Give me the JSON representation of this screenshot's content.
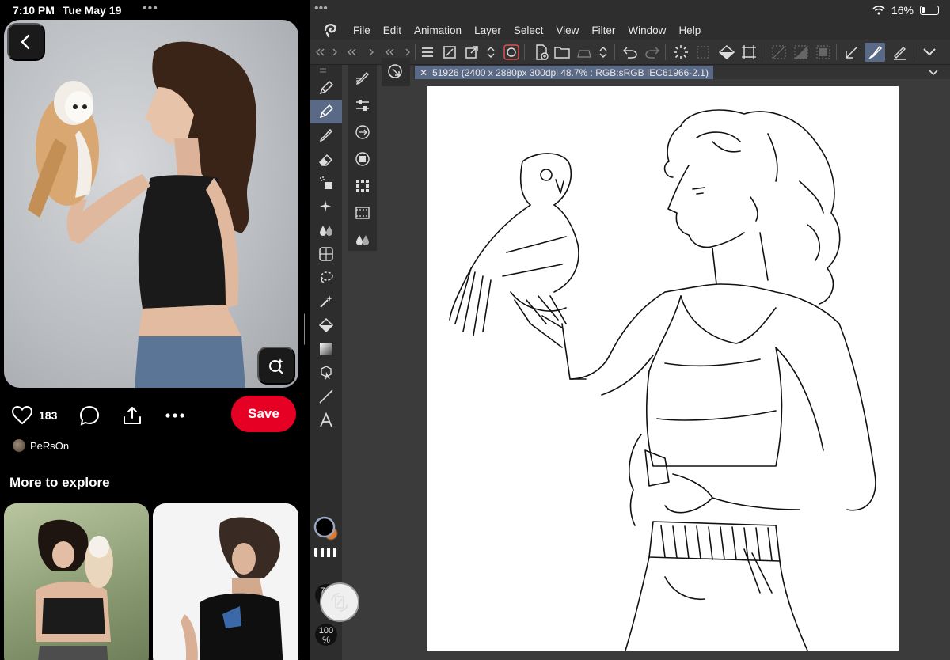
{
  "left": {
    "status": {
      "time": "7:10 PM",
      "date": "Tue May 19"
    },
    "pin": {
      "likes": "183",
      "save_label": "Save",
      "author": "PeRsOn"
    },
    "explore": {
      "title": "More to explore"
    }
  },
  "right": {
    "status": {
      "battery": "16%"
    },
    "menu": [
      "File",
      "Edit",
      "Animation",
      "Layer",
      "Select",
      "View",
      "Filter",
      "Window",
      "Help"
    ],
    "tab": {
      "label": "51926 (2400 x 2880px 300dpi 48.7% : RGB:sRGB IEC61966-2.1)"
    },
    "brush": {
      "size_value": "7.0",
      "size_unit": "px",
      "opacity_value": "100",
      "opacity_unit": "%"
    },
    "colors": {
      "main": "#000000",
      "sub": "#e07a30",
      "accent": "#5a6a86"
    }
  },
  "icons": [
    "chevron-left-icon",
    "visual-search-icon",
    "heart-icon",
    "comment-icon",
    "share-icon",
    "more-icon",
    "clip-studio-logo-icon",
    "pen-icon",
    "eraser-icon",
    "lasso-icon",
    "text-icon",
    "rotate-canvas-icon",
    "wifi-icon",
    "battery-icon"
  ]
}
